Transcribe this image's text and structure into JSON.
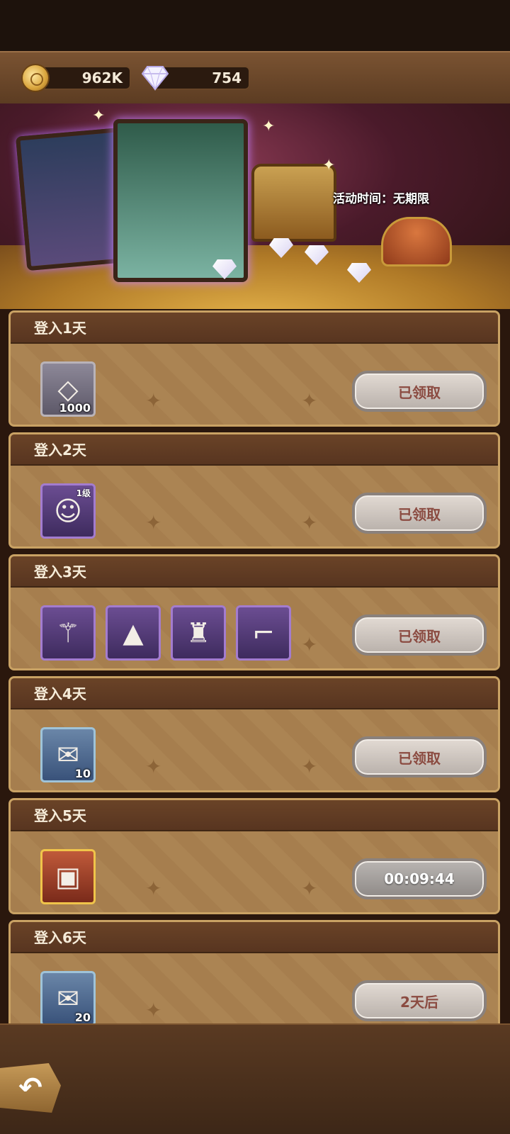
{
  "currency": {
    "coins": "962K",
    "gems": "754"
  },
  "banner": {
    "event_time": "活动时间：无期限"
  },
  "days": [
    {
      "title": "登入1天",
      "items": [
        {
          "icon": "diamond-icon",
          "quantity": "1000",
          "level": ""
        }
      ],
      "button": "已领取",
      "status": "claimed"
    },
    {
      "title": "登入2天",
      "items": [
        {
          "icon": "hero-portrait-icon",
          "quantity": "",
          "level": "1级"
        }
      ],
      "button": "已领取",
      "status": "claimed"
    },
    {
      "title": "登入3天",
      "items": [
        {
          "icon": "staff-icon",
          "quantity": "",
          "level": ""
        },
        {
          "icon": "wizard-hat-icon",
          "quantity": "",
          "level": ""
        },
        {
          "icon": "robe-icon",
          "quantity": "",
          "level": ""
        },
        {
          "icon": "boots-icon",
          "quantity": "",
          "level": ""
        }
      ],
      "button": "已领取",
      "status": "claimed"
    },
    {
      "title": "登入4天",
      "items": [
        {
          "icon": "scroll-icon",
          "quantity": "10",
          "level": ""
        }
      ],
      "button": "已领取",
      "status": "claimed"
    },
    {
      "title": "登入5天",
      "items": [
        {
          "icon": "treasure-chest-icon",
          "quantity": "",
          "level": ""
        }
      ],
      "button": "00:09:44",
      "status": "countdown"
    },
    {
      "title": "登入6天",
      "items": [
        {
          "icon": "scroll-icon",
          "quantity": "20",
          "level": ""
        }
      ],
      "button": "2天后",
      "status": "locked"
    }
  ],
  "colors": {
    "claimed_text": "#8b4b41",
    "panel": "#a77f4f",
    "header": "#5e3a22",
    "frame": "#c9a264"
  },
  "nav": {
    "back_icon": "back-arrow-icon"
  }
}
